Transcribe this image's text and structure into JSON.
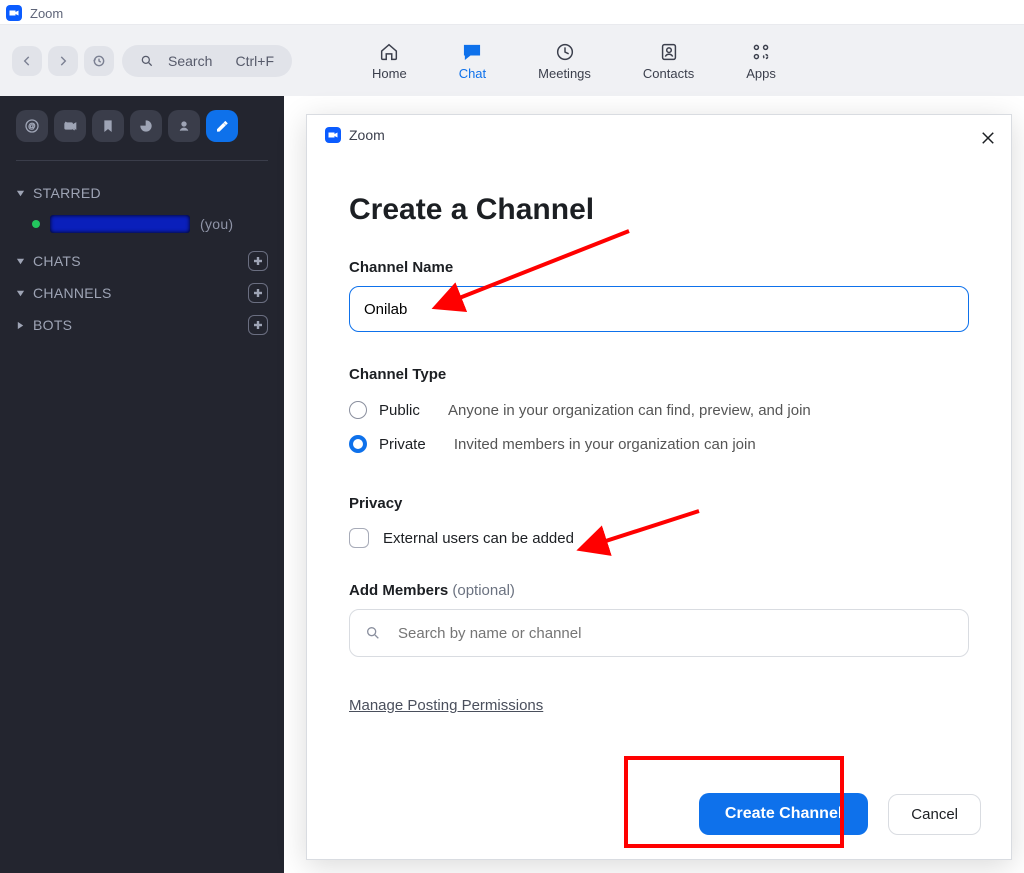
{
  "titlebar": {
    "app_name": "Zoom"
  },
  "toolbar": {
    "search_placeholder": "Search",
    "search_shortcut": "Ctrl+F",
    "tabs": {
      "home": "Home",
      "chat": "Chat",
      "meetings": "Meetings",
      "contacts": "Contacts",
      "apps": "Apps"
    }
  },
  "sidebar": {
    "groups": {
      "starred": "STARRED",
      "chats": "CHATS",
      "channels": "CHANNELS",
      "bots": "BOTS"
    },
    "you_suffix": "(you)"
  },
  "dialog": {
    "window_title": "Zoom",
    "heading": "Create a Channel",
    "channel_name_label": "Channel Name",
    "channel_name_value": "Onilab",
    "channel_type_label": "Channel Type",
    "type_public_label": "Public",
    "type_public_desc": "Anyone in your organization can find, preview, and join",
    "type_private_label": "Private",
    "type_private_desc": "Invited members in your organization can join",
    "privacy_label": "Privacy",
    "external_users_label": "External users can be added",
    "add_members_label": "Add Members",
    "add_members_optional": "(optional)",
    "add_members_placeholder": "Search by name or channel",
    "manage_permissions": "Manage Posting Permissions",
    "create_button": "Create Channel",
    "cancel_button": "Cancel"
  }
}
